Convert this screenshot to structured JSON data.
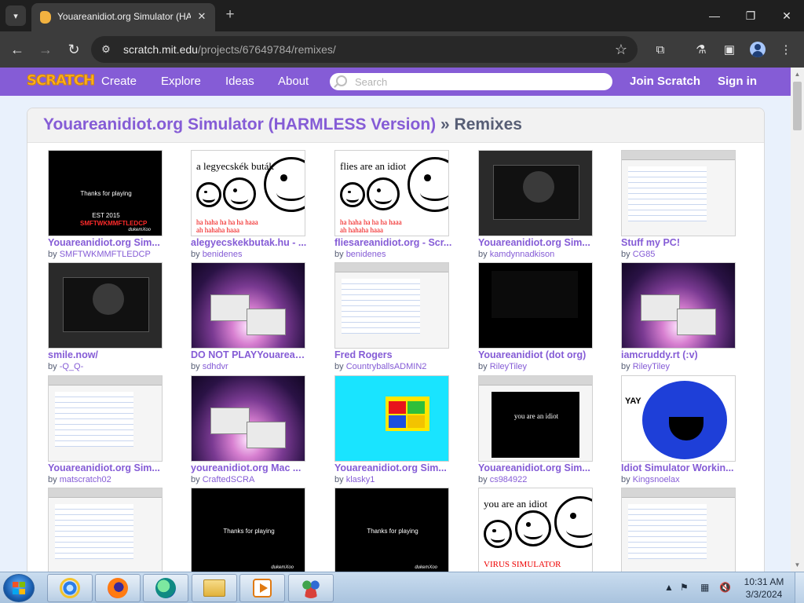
{
  "browser": {
    "tab_title": "Youareanidiot.org Simulator (HARM",
    "url_host": "scratch.mit.edu",
    "url_path": "/projects/67649784/remixes/"
  },
  "scratch": {
    "logo": "SCRATCH",
    "nav": [
      "Create",
      "Explore",
      "Ideas",
      "About"
    ],
    "search_placeholder": "Search",
    "join": "Join Scratch",
    "signin": "Sign in"
  },
  "header": {
    "project_title": "Youareanidiot.org Simulator (HARMLESS Version)",
    "separator": "»",
    "section": "Remixes"
  },
  "by_label": "by",
  "projects": [
    {
      "title": "Youareanidiot.org Sim...",
      "author": "SMFTWKMMFTLEDCP",
      "thumb": "thanks"
    },
    {
      "title": "alegyecskekbutak.hu - ...",
      "author": "benidenes",
      "thumb": "faces",
      "caption": "a legyecskék buták",
      "laugh": [
        "ha haha ha ha ha haaa",
        "ah hahaha haaa"
      ]
    },
    {
      "title": "fliesareanidiot.org - Scr...",
      "author": "benidenes",
      "thumb": "faces",
      "caption": "flies are an idiot",
      "laugh": [
        "ha haha ha ha ha haaa",
        "ah hahaha haaa"
      ]
    },
    {
      "title": "Youareanidiot.org Sim...",
      "author": "kamdynnadkison",
      "thumb": "dark"
    },
    {
      "title": "Stuff my PC!",
      "author": "CG85",
      "thumb": "screen"
    },
    {
      "title": "smile.now/",
      "author": "-Q_Q-",
      "thumb": "dark"
    },
    {
      "title": "DO NOT PLAYYouareani...",
      "author": "sdhdvr",
      "thumb": "space"
    },
    {
      "title": "Fred Rogers",
      "author": "CountryballsADMIN2",
      "thumb": "screen"
    },
    {
      "title": "Youareanidiot (dot org)",
      "author": "RileyTiley",
      "thumb": "black"
    },
    {
      "title": "iamcruddy.rt (:v)",
      "author": "RileyTiley",
      "thumb": "space"
    },
    {
      "title": "Youareanidiot.org Sim...",
      "author": "matscratch02",
      "thumb": "screen"
    },
    {
      "title": "youreanidiot.org Mac ...",
      "author": "CraftedSCRA",
      "thumb": "space"
    },
    {
      "title": "Youareanidiot.org Sim...",
      "author": "klasky1",
      "thumb": "cyan"
    },
    {
      "title": "Youareanidiot.org Sim...",
      "author": "cs984922",
      "thumb": "idiotbox",
      "caption": "you are an idiot"
    },
    {
      "title": "Idiot Simulator Workin...",
      "author": "Kingsnoelax",
      "thumb": "yay",
      "caption": "YAY"
    },
    {
      "title": "",
      "author": "",
      "thumb": "screen"
    },
    {
      "title": "",
      "author": "",
      "thumb": "thanks"
    },
    {
      "title": "",
      "author": "",
      "thumb": "thanks"
    },
    {
      "title": "",
      "author": "",
      "thumb": "virus",
      "caption": "you are an idiot",
      "laugh": [
        "VIRUS SIMULATOR"
      ]
    },
    {
      "title": "",
      "author": "",
      "thumb": "screen"
    }
  ],
  "thumb_text": {
    "thanks": "Thanks for playing",
    "est": "EST 2015",
    "brand": "SMFTWKMMFTLEDCP",
    "signature": "dukemXoo"
  },
  "taskbar": {
    "time": "10:31 AM",
    "date": "3/3/2024",
    "apps": [
      "internet-explorer",
      "firefox",
      "edge",
      "file-explorer",
      "media-player",
      "people"
    ]
  },
  "colors": {
    "scratch_purple": "#855cd6",
    "chrome_dark": "#3c3c3c"
  }
}
